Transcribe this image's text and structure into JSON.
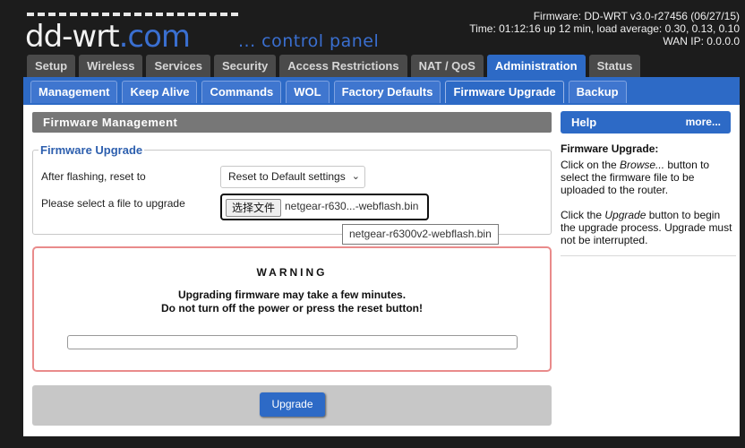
{
  "header": {
    "logo_prefix": "dd-wrt",
    "logo_suffix": ".com",
    "logo_subtitle": "... control panel",
    "firmware": "Firmware: DD-WRT v3.0-r27456 (06/27/15)",
    "time": "Time: 01:12:16 up 12 min, load average: 0.30, 0.13, 0.10",
    "wan_ip": "WAN IP: 0.0.0.0"
  },
  "main_tabs": [
    {
      "label": "Setup"
    },
    {
      "label": "Wireless"
    },
    {
      "label": "Services"
    },
    {
      "label": "Security"
    },
    {
      "label": "Access Restrictions"
    },
    {
      "label": "NAT / QoS"
    },
    {
      "label": "Administration",
      "active": true
    },
    {
      "label": "Status"
    }
  ],
  "sub_tabs": [
    {
      "label": "Management"
    },
    {
      "label": "Keep Alive"
    },
    {
      "label": "Commands"
    },
    {
      "label": "WOL"
    },
    {
      "label": "Factory Defaults"
    },
    {
      "label": "Firmware Upgrade",
      "active": true
    },
    {
      "label": "Backup"
    }
  ],
  "section": {
    "title": "Firmware Management",
    "legend": "Firmware Upgrade",
    "reset_label": "After flashing, reset to",
    "reset_value": "Reset to Default settings",
    "file_label": "Please select a file to upgrade",
    "file_button": "选择文件",
    "file_name_display": "netgear-r630...-webflash.bin",
    "tooltip": "netgear-r6300v2-webflash.bin"
  },
  "warning": {
    "title": "WARNING",
    "line1": "Upgrading firmware may take a few minutes.",
    "line2": "Do not turn off the power or press the reset button!",
    "progress": 0
  },
  "actions": {
    "upgrade_label": "Upgrade"
  },
  "help": {
    "title": "Help",
    "more": "more...",
    "heading": "Firmware Upgrade:",
    "p1_a": "Click on the ",
    "p1_em": "Browse...",
    "p1_b": " button to select the firmware file to be uploaded to the router.",
    "p2_a": "Click the ",
    "p2_em": "Upgrade",
    "p2_b": " button to begin the upgrade process. Upgrade must not be interrupted."
  },
  "colors": {
    "accent": "#2d6ac6",
    "warning_border": "#e98b8b",
    "background": "#1c1c1c"
  }
}
